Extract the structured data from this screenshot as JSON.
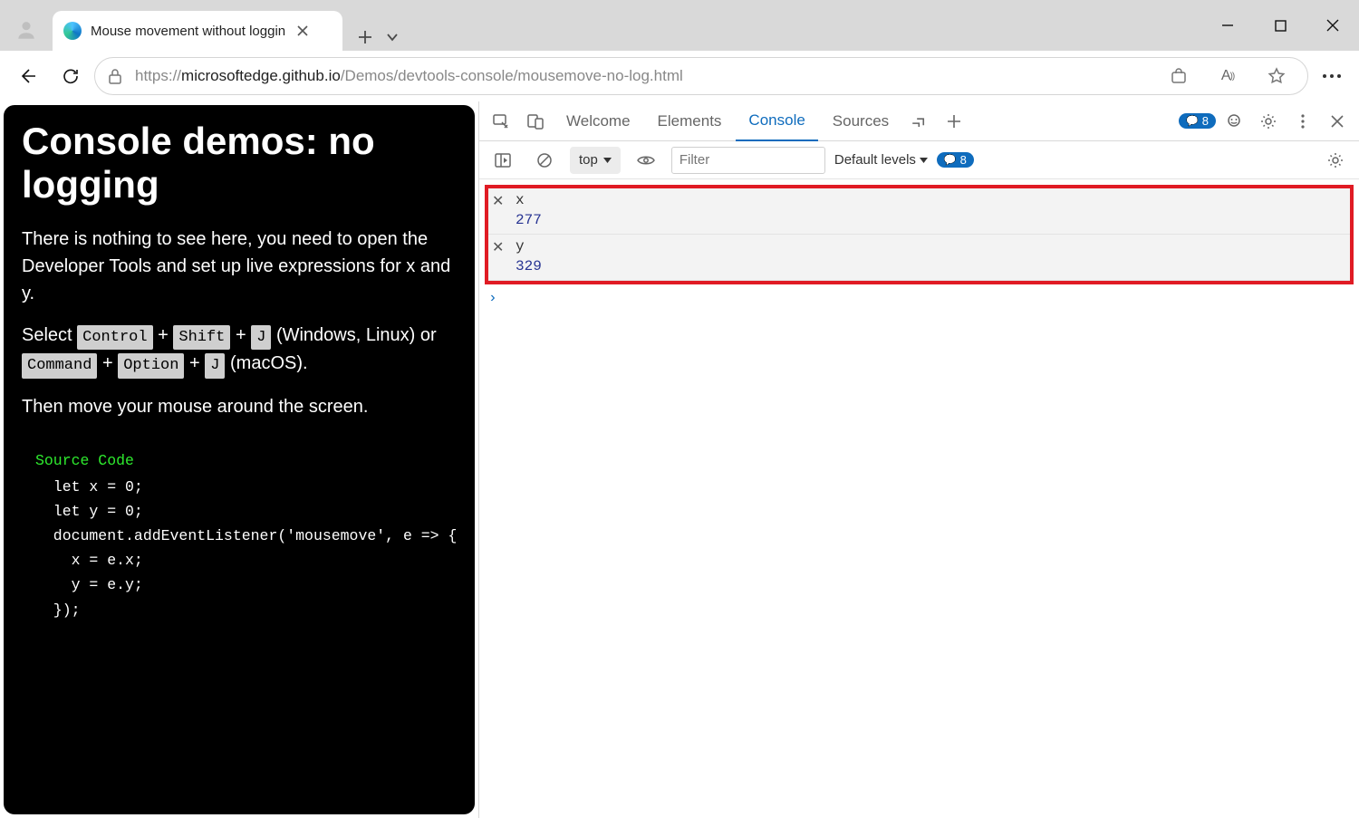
{
  "browser": {
    "tab_title": "Mouse movement without loggin",
    "url_prefix": "https://",
    "url_host": "microsoftedge.github.io",
    "url_path": "/Demos/devtools-console/mousemove-no-log.html"
  },
  "page": {
    "heading": "Console demos: no logging",
    "para1": "There is nothing to see here, you need to open the Developer Tools and set up live expressions for x and y.",
    "para2_pre": "Select ",
    "k_ctrl": "Control",
    "plus": " + ",
    "k_shift": "Shift",
    "k_j": "J",
    "para2_mid": " (Windows, Linux) or ",
    "k_cmd": "Command",
    "k_opt": "Option",
    "para2_end": " (macOS).",
    "para3": "Then move your mouse around the screen.",
    "source_label": "Source Code",
    "code": "  let x = 0;\n  let y = 0;\n  document.addEventListener('mousemove', e => {\n    x = e.x;\n    y = e.y;\n  });"
  },
  "devtools": {
    "tabs": {
      "welcome": "Welcome",
      "elements": "Elements",
      "console": "Console",
      "sources": "Sources"
    },
    "issues_count": "8",
    "subbar": {
      "context": "top",
      "filter_placeholder": "Filter",
      "levels": "Default levels",
      "messages_count": "8"
    },
    "live": [
      {
        "name": "x",
        "value": "277"
      },
      {
        "name": "y",
        "value": "329"
      }
    ],
    "prompt": "›"
  }
}
